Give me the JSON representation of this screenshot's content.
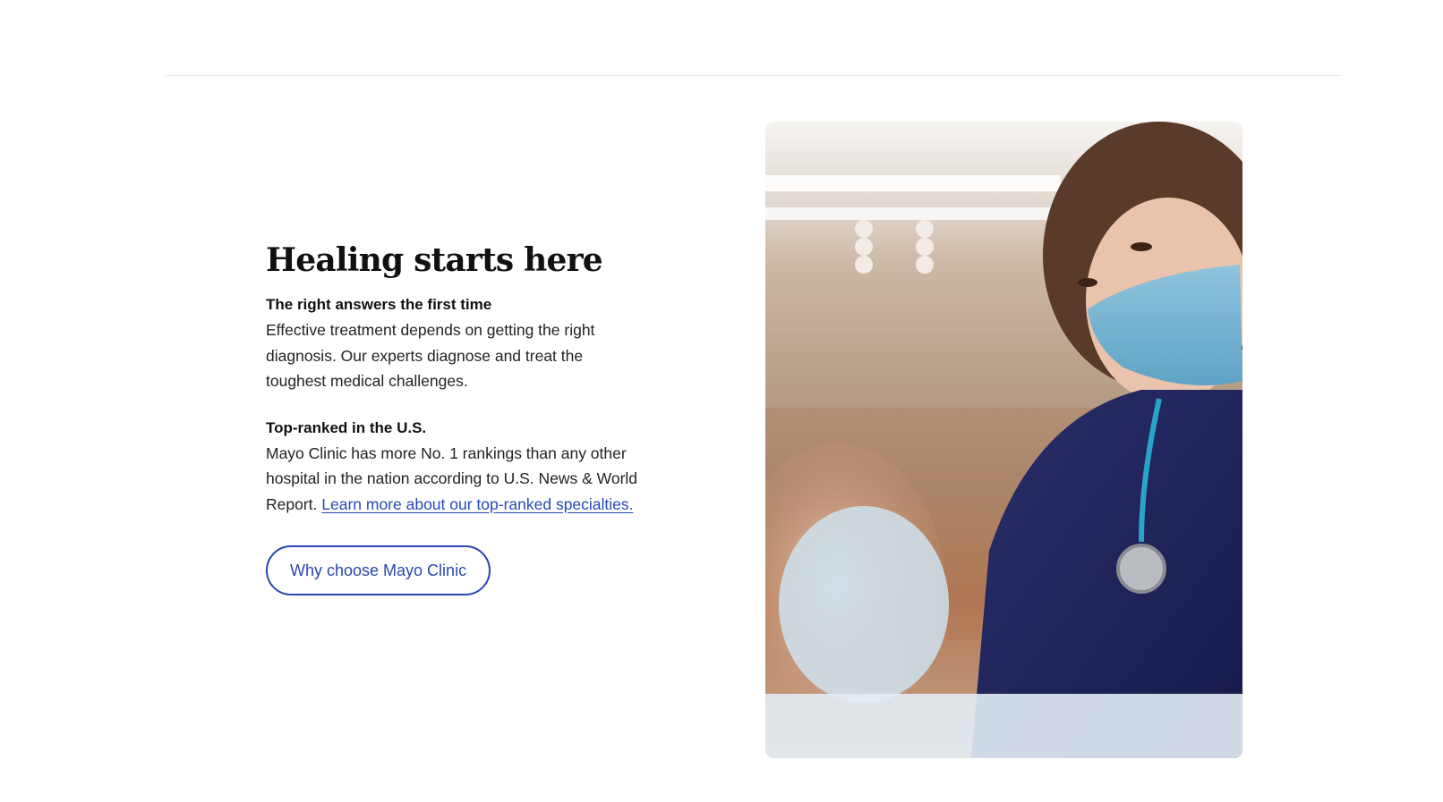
{
  "heading": "Healing starts here",
  "sections": [
    {
      "title": "The right answers the first time",
      "body": "Effective treatment depends on getting the right diagnosis. Our experts diagnose and treat the toughest medical challenges."
    },
    {
      "title": "Top-ranked in the U.S.",
      "body": "Mayo Clinic has more No. 1 rankings than any other hospital in the nation according to U.S. News & World Report. ",
      "link_text": "Learn more about our top-ranked specialties."
    }
  ],
  "cta_label": "Why choose Mayo Clinic",
  "image": {
    "description_icon": "photo-icon"
  },
  "colors": {
    "link": "#2749b5",
    "cta_border": "#2a46b0",
    "heading": "#111111"
  }
}
